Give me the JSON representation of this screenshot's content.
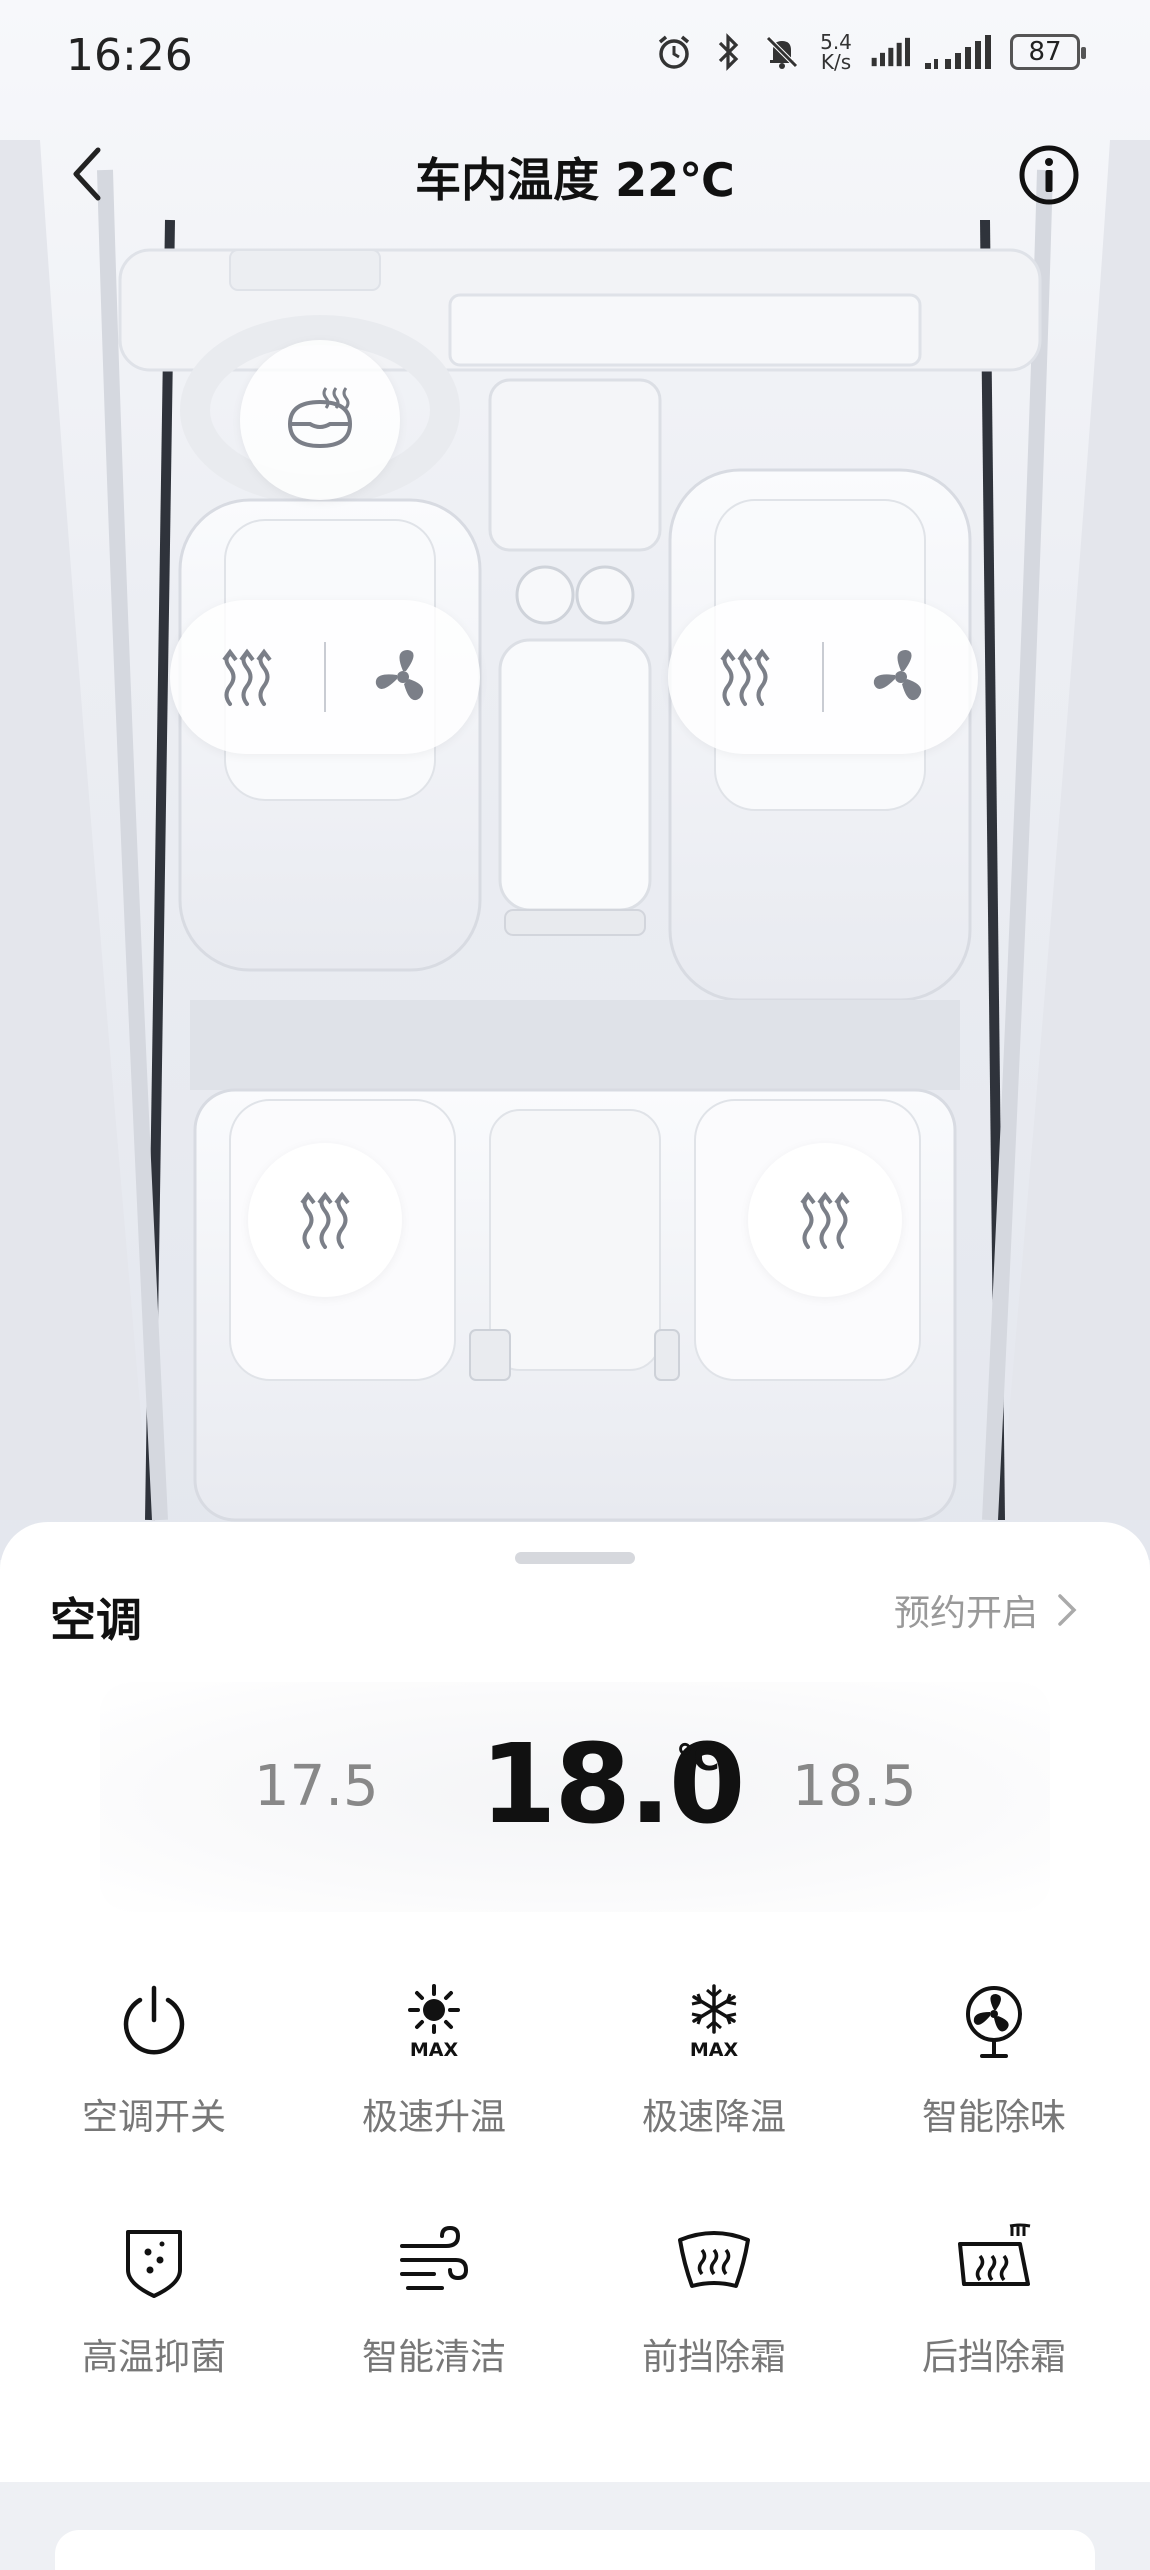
{
  "status_bar": {
    "time": "16:26",
    "net_speed_value": "5.4",
    "net_speed_unit": "K/s",
    "battery": "87"
  },
  "nav": {
    "title": "车内温度 22℃"
  },
  "ac": {
    "section_title": "空调",
    "schedule_label": "预约开启",
    "temp_lower": "17.5",
    "temp_current": "18.0",
    "temp_unit": "℃",
    "temp_higher": "18.5"
  },
  "controls": [
    {
      "label": "空调开关",
      "icon": "power-icon"
    },
    {
      "label": "极速升温",
      "icon": "sun-max-icon"
    },
    {
      "label": "极速降温",
      "icon": "snowflake-max-icon"
    },
    {
      "label": "智能除味",
      "icon": "fan-icon"
    },
    {
      "label": "高温抑菌",
      "icon": "shield-icon"
    },
    {
      "label": "智能清洁",
      "icon": "wind-icon"
    },
    {
      "label": "前挡除霜",
      "icon": "front-defrost-icon"
    },
    {
      "label": "后挡除霜",
      "icon": "rear-defrost-icon"
    }
  ],
  "icon_text": "MAX",
  "colors": {
    "accent": "#111111",
    "muted": "#888888",
    "icon": "#7b7f88"
  }
}
